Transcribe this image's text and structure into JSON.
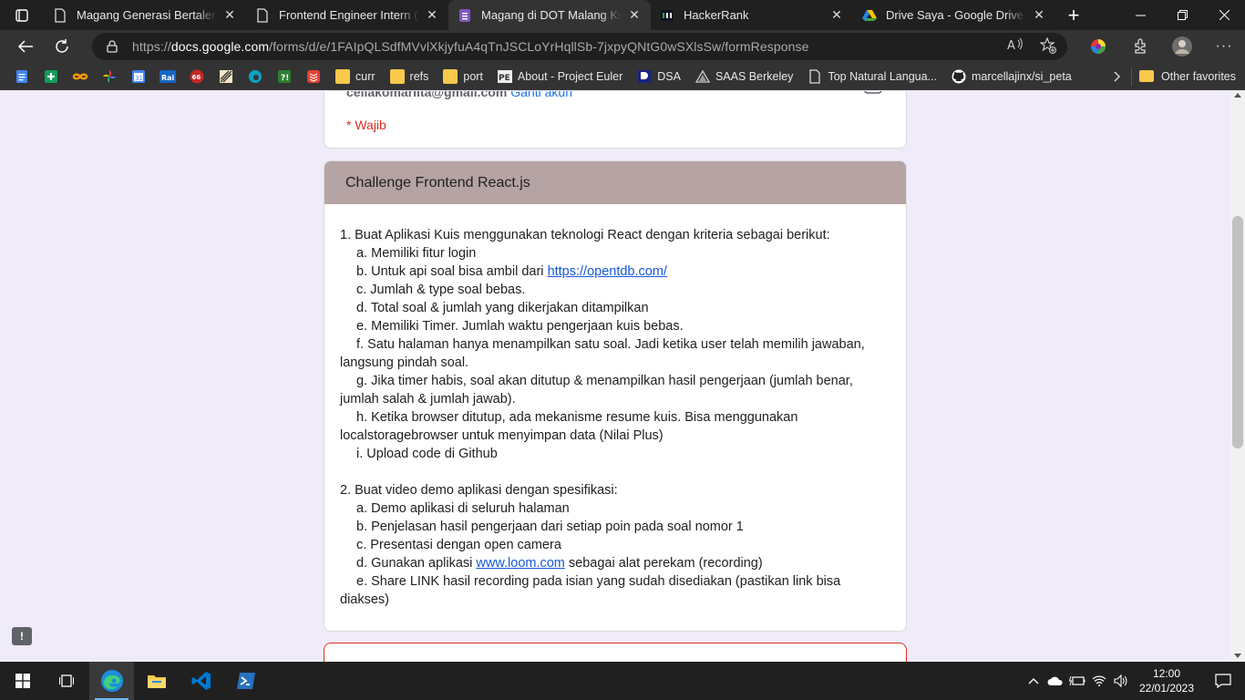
{
  "tabs": [
    {
      "title": "Magang Generasi Bertalenta",
      "icon": "page-icon",
      "active": false
    },
    {
      "title": "Frontend Engineer Intern (Re",
      "icon": "page-icon",
      "active": false
    },
    {
      "title": "Magang di DOT Malang Kuy",
      "icon": "google-forms-icon",
      "active": true
    },
    {
      "title": "HackerRank",
      "icon": "hackerrank-icon",
      "active": false
    },
    {
      "title": "Drive Saya - Google Drive",
      "icon": "google-drive-icon",
      "active": false
    }
  ],
  "address": {
    "prefix": "https://",
    "host": "docs.google.com",
    "path": "/forms/d/e/1FAIpQLSdfMVvlXkjyfuA4qTnJSCLoYrHqllSb-7jxpyQNtG0wSXlsSw/formResponse"
  },
  "bookmarks": [
    {
      "label": "curr",
      "type": "folder"
    },
    {
      "label": "refs",
      "type": "folder"
    },
    {
      "label": "port",
      "type": "folder"
    },
    {
      "label": "About - Project Euler",
      "type": "site"
    },
    {
      "label": "DSA",
      "type": "site"
    },
    {
      "label": "SAAS Berkeley",
      "type": "site"
    },
    {
      "label": "Top Natural Langua...",
      "type": "site"
    },
    {
      "label": "marcellajinx/si_peta",
      "type": "site"
    }
  ],
  "bookmarks_other": "Other favorites",
  "form": {
    "account_email": "cellakomariita@gmail.com",
    "account_switch": "Ganti akun",
    "required_note": "* Wajib",
    "section_title": "Challenge Frontend React.js",
    "body": {
      "p1": "1. Buat Aplikasi Kuis menggunakan teknologi React dengan kriteria sebagai berikut:",
      "a": "a. Memiliki fitur login",
      "b_pre": "b. Untuk api soal bisa ambil dari ",
      "b_link": "https://opentdb.com/",
      "c": "c. Jumlah & type soal bebas.",
      "d": "d. Total soal & jumlah yang dikerjakan ditampilkan",
      "e": "e. Memiliki Timer. Jumlah waktu pengerjaan kuis bebas.",
      "f1": "f. Satu halaman hanya menampilkan satu soal. Jadi ketika user telah memilih jawaban,",
      "f2": "langsung pindah soal.",
      "g1": "g. Jika timer habis, soal akan ditutup & menampilkan hasil pengerjaan (jumlah benar,",
      "g2": "jumlah salah & jumlah jawab).",
      "h1": "h. Ketika browser ditutup, ada mekanisme resume kuis. Bisa menggunakan",
      "h2": "localstoragebrowser untuk menyimpan data (Nilai Plus)",
      "i": "i. Upload code di Github",
      "p2": "2. Buat video demo aplikasi dengan spesifikasi:",
      "a2": "a. Demo aplikasi di seluruh halaman",
      "b2": "b. Penjelasan hasil pengerjaan dari setiap poin pada soal nomor 1",
      "c2": "c. Presentasi dengan open camera",
      "d2_pre": "d. Gunakan aplikasi ",
      "d2_link": "www.loom.com",
      "d2_post": " sebagai alat perekam (recording)",
      "e2_1": "e. Share LINK hasil recording pada isian yang sudah disediakan (pastikan link bisa",
      "e2_2": "diakses)"
    }
  },
  "clock": {
    "time": "12:00",
    "date": "22/01/2023"
  },
  "colors": {
    "section_header": "#b6a3a3",
    "page_bg": "#f0ebf8",
    "required": "#d93025",
    "link": "#1558d6"
  }
}
